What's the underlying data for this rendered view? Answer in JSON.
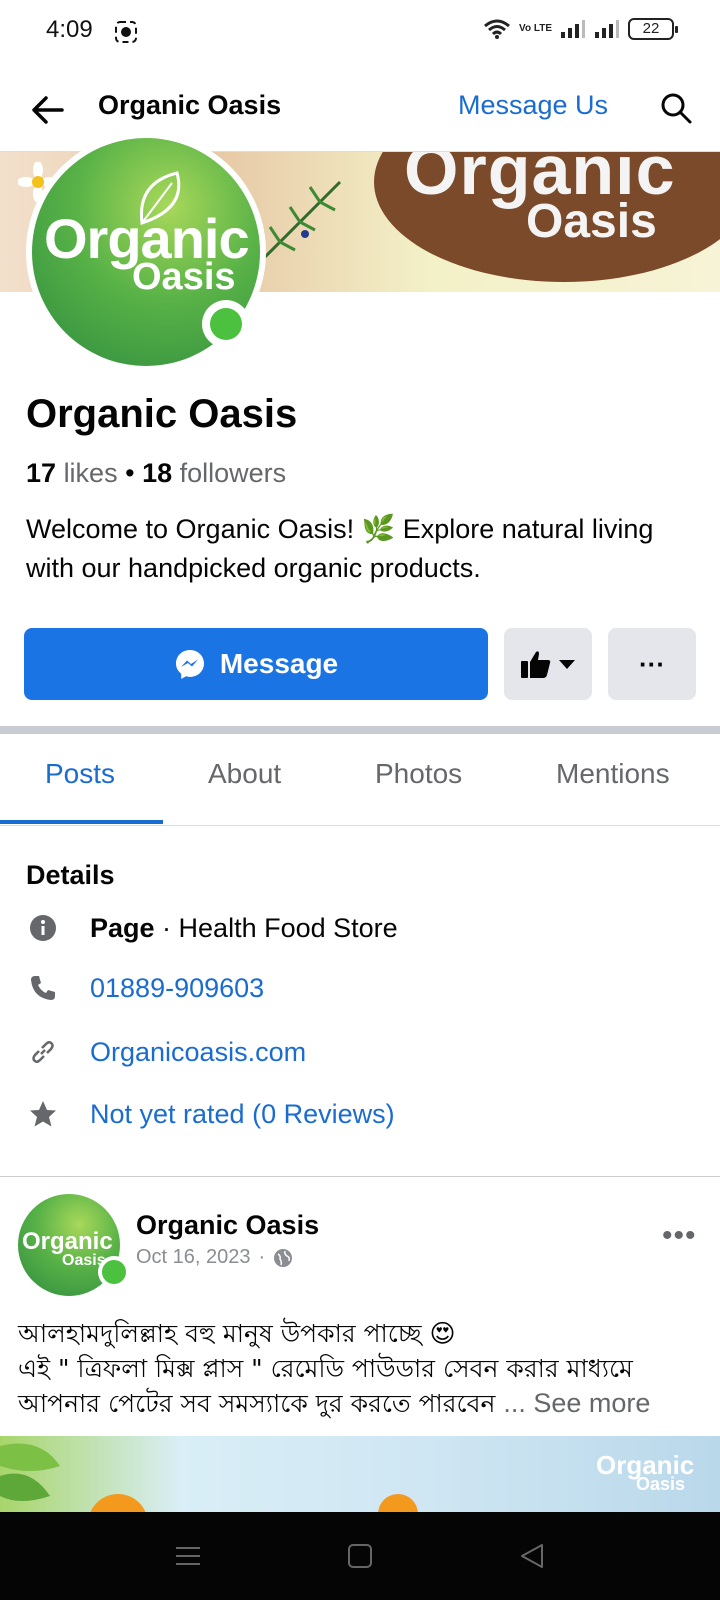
{
  "status_bar": {
    "time": "4:09",
    "battery": "22",
    "network_label": "Vo LTE"
  },
  "header": {
    "title": "Organic Oasis",
    "message_us": "Message Us"
  },
  "cover": {
    "logo_line1": "Organic",
    "logo_line2": "Oasis"
  },
  "avatar": {
    "line1": "Organic",
    "line2": "Oasis"
  },
  "profile": {
    "name": "Organic Oasis",
    "likes_count": "17",
    "likes_label": "likes",
    "followers_count": "18",
    "followers_label": "followers",
    "bio": "Welcome to Organic Oasis! 🌿 Explore natural living with our handpicked organic products."
  },
  "actions": {
    "message_label": "Message",
    "more_label": "···"
  },
  "tabs": [
    {
      "label": "Posts",
      "active": true
    },
    {
      "label": "About",
      "active": false
    },
    {
      "label": "Photos",
      "active": false
    },
    {
      "label": "Mentions",
      "active": false
    }
  ],
  "details": {
    "title": "Details",
    "page_type_bold": "Page",
    "page_type_rest": " · Health Food Store",
    "phone": "01889-909603",
    "website": "Organicoasis.com",
    "rating": "Not yet rated (0 Reviews)"
  },
  "post": {
    "author": "Organic Oasis",
    "date": "Oct 16, 2023",
    "separator": "·",
    "more": "•••",
    "text_line1": "আলহামদুলিল্লাহ বহু মানুষ উপকার পাচ্ছে 😍",
    "text_line2": "এই \" ত্রিফলা মিক্স প্লাস \" রেমেডি পাউডার সেবন করার মাধ্যমে",
    "text_line3": "আপনার পেটের সব সমস্যাকে দুর করতে পারবেন ",
    "see_more": "... See more",
    "image_logo1": "Organic",
    "image_logo2": "Oasis"
  },
  "colors": {
    "accent": "#1b74e4",
    "link": "#1b6cd1",
    "online": "#4bc13f",
    "secondary_text": "#65676b"
  },
  "icons": [
    "back-arrow-icon",
    "search-icon",
    "messenger-icon",
    "thumbs-up-icon",
    "caret-down-icon",
    "info-icon",
    "phone-icon",
    "link-icon",
    "star-icon",
    "globe-icon"
  ]
}
